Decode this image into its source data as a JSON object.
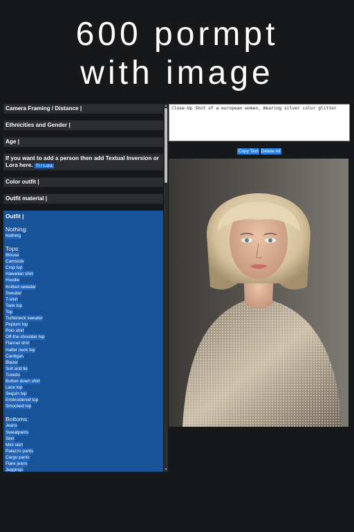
{
  "title": {
    "line1": "600 pormpt",
    "line2": "with image"
  },
  "sections": {
    "camera": "Camera Framing / Distance |",
    "ethnicity": "Ethnicities and Gender |",
    "age": "Age |",
    "person_line1": "If you want to add a person then add Textual Inversion or",
    "person_line2": "Lora here.",
    "person_tag": "TI / Lora",
    "color": "Color outfit |",
    "material": "Outfit material |"
  },
  "outfit": {
    "header": "Outfit |",
    "nothing_label": "Nothing:",
    "nothing_items": [
      "Nothing"
    ],
    "tops_label": "Tops:",
    "tops": [
      "Blouse",
      "Camisole",
      "Crop top",
      "Hawaiian shirt",
      "Hoodie",
      "Knitted sweater",
      "Sweater",
      "T-shirt",
      "Tank top",
      "Top",
      "Turtleneck sweater",
      "Peplum top",
      "Polo shirt",
      "Off-the-shoulder top",
      "Flannel shirt",
      "Halter neck top",
      "Cardigan",
      "Blazer",
      "Suit and tie",
      "Tuxedo",
      "Button-down shirt",
      "Lace top",
      "Sequin top",
      "Embroidered top",
      "Smocked top"
    ],
    "bottoms_label": "Bottoms:",
    "bottoms": [
      "Jeans",
      "Sweatpants",
      "Skirt",
      "Mini skirt",
      "Palazzo pants",
      "Cargo pants",
      "Flare jeans",
      "Jeggings"
    ]
  },
  "prompt": {
    "text": "Close-Up Shot of a european women, Wearing silver color glitter"
  },
  "buttons": {
    "copy": "Copy Text",
    "delete": "Delete All"
  },
  "colors": {
    "bg": "#17181a",
    "section": "#2b2d32",
    "outfit_bg": "#18539a",
    "accent": "#1d6fd6"
  }
}
